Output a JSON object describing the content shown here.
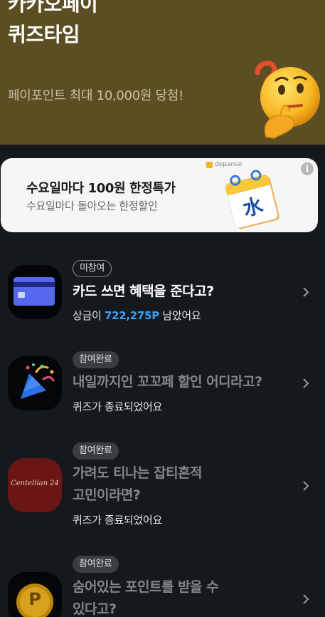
{
  "hero": {
    "title_line1": "카카오페이",
    "title_line2": "퀴즈타임",
    "subtitle": "페이포인트 최대 10,000원 당첨!",
    "bg_color": "#5b4e22",
    "icon": "thinking-face-icon"
  },
  "banner": {
    "title": "수요일마다 100원 한정특가",
    "subtitle": "수요일마다 돌아오는 한정할인",
    "sponsor": "depanse",
    "info_icon": "i",
    "calendar_char": "水"
  },
  "quizzes": [
    {
      "badge": "미참여",
      "title_lines": [
        "카드 쓰면 혜택을 준다고?"
      ],
      "status_prefix": "상금이 ",
      "status_prize": "722,275P",
      "status_suffix": " 남았어요",
      "icon": "credit-card-icon",
      "active": true
    },
    {
      "badge": "참여완료",
      "title_lines": [
        "내일까지인 꼬꼬페 할인 어디라고?"
      ],
      "status": "퀴즈가 종료되었어요",
      "icon": "party-popper-icon",
      "active": false
    },
    {
      "badge": "참여완료",
      "title_lines": [
        "가려도 티나는 잡티흔적",
        "고민이라면?"
      ],
      "status": "퀴즈가 종료되었어요",
      "icon": "centellian-logo",
      "icon_text": "Centellian 24",
      "active": false
    },
    {
      "badge": "참여완료",
      "title_lines": [
        "숨어있는 포인트를 받을 수",
        "있다고?"
      ],
      "icon": "point-coin-icon",
      "icon_text": "P",
      "active": false
    }
  ],
  "colors": {
    "background": "#15181d",
    "prize": "#3aa0f5",
    "inactive_title": "#84868a"
  }
}
